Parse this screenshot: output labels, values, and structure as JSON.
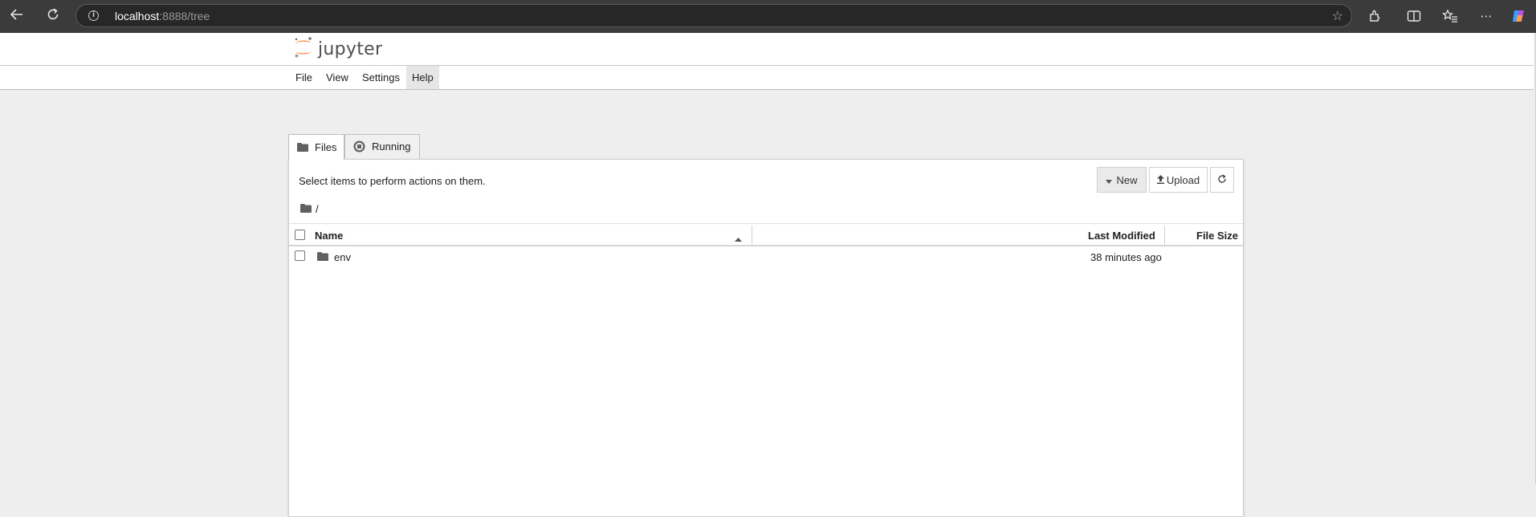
{
  "browser": {
    "url_host": "localhost",
    "url_rest": ":8888/tree"
  },
  "app": {
    "logo_text": "jupyter"
  },
  "menu": [
    {
      "label": "File"
    },
    {
      "label": "View"
    },
    {
      "label": "Settings"
    },
    {
      "label": "Help"
    }
  ],
  "tabs": [
    {
      "label": "Files"
    },
    {
      "label": "Running"
    }
  ],
  "file_browser": {
    "hint": "Select items to perform actions on them.",
    "new_label": "New",
    "upload_label": "Upload",
    "breadcrumb": "/",
    "columns": {
      "name": "Name",
      "last_modified": "Last Modified",
      "file_size": "File Size"
    },
    "rows": [
      {
        "name": "env",
        "last_modified": "38 minutes ago",
        "file_size": ""
      }
    ]
  },
  "colors": {
    "jupyter_orange": "#f37726",
    "chrome_bg": "#3b3b3b"
  }
}
